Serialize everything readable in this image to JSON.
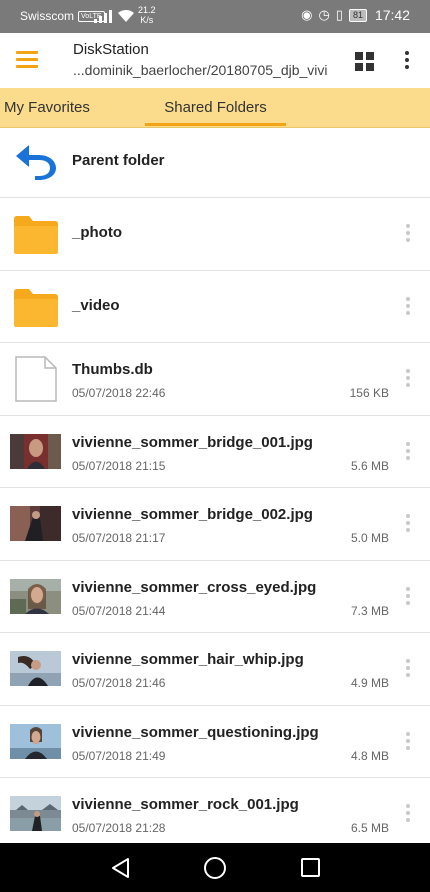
{
  "status_bar": {
    "carrier": "Swisscom",
    "volte": "VoLTE",
    "speed_value": "21.2",
    "speed_unit": "K/s",
    "battery": "81",
    "time": "17:42"
  },
  "app_bar": {
    "title": "DiskStation",
    "path": "...dominik_baerlocher/20180705_djb_vivi",
    "menu_icon": "hamburger-icon",
    "view_icon": "grid-view-icon",
    "more_icon": "more-vert-icon",
    "accent_color": "#f3a316"
  },
  "tabs": [
    {
      "label": "My Favorites",
      "selected": false
    },
    {
      "label": "Shared Folders",
      "selected": true
    }
  ],
  "tab_bar_color": "#fbdc8d",
  "parent_row": {
    "label": "Parent folder",
    "icon": "back-arrow-icon"
  },
  "items": [
    {
      "name": "_photo",
      "type": "folder",
      "icon": "folder-icon"
    },
    {
      "name": "_video",
      "type": "folder",
      "icon": "folder-icon"
    },
    {
      "name": "Thumbs.db",
      "type": "file",
      "icon": "file-icon",
      "date": "05/07/2018 22:46",
      "size": "156 KB"
    },
    {
      "name": "vivienne_sommer_bridge_001.jpg",
      "type": "image",
      "date": "05/07/2018 21:15",
      "size": "5.6 MB"
    },
    {
      "name": "vivienne_sommer_bridge_002.jpg",
      "type": "image",
      "date": "05/07/2018 21:17",
      "size": "5.0 MB"
    },
    {
      "name": "vivienne_sommer_cross_eyed.jpg",
      "type": "image",
      "date": "05/07/2018 21:44",
      "size": "7.3 MB"
    },
    {
      "name": "vivienne_sommer_hair_whip.jpg",
      "type": "image",
      "date": "05/07/2018 21:46",
      "size": "4.9 MB"
    },
    {
      "name": "vivienne_sommer_questioning.jpg",
      "type": "image",
      "date": "05/07/2018 21:49",
      "size": "4.8 MB"
    },
    {
      "name": "vivienne_sommer_rock_001.jpg",
      "type": "image",
      "date": "05/07/2018 21:28",
      "size": "6.5 MB"
    }
  ],
  "nav_bar": {
    "back_icon": "nav-back-icon",
    "home_icon": "nav-home-icon",
    "recents_icon": "nav-recents-icon"
  }
}
